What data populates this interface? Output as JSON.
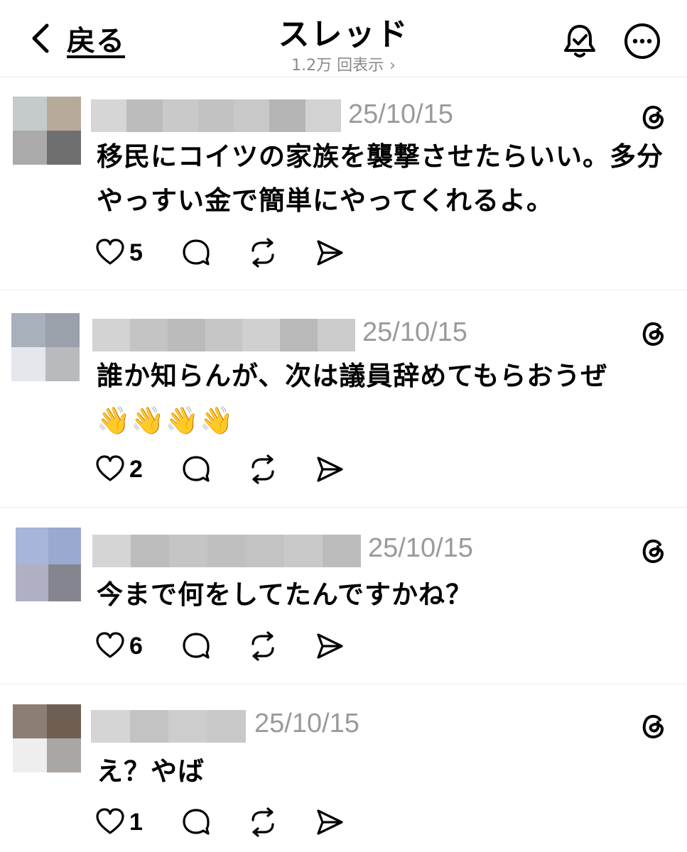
{
  "header": {
    "back_label": "戻る",
    "title": "スレッド",
    "views": "1.2万 回表示",
    "views_chevron": "›"
  },
  "posts": [
    {
      "date": "25/10/15",
      "text": "移民にコイツの家族を襲撃させたらいい。多分やっすい金で簡単にやってくれるよ。",
      "likes": "5"
    },
    {
      "date": "25/10/15",
      "text": "誰か知らんが、次は議員辞めてもらおうぜ",
      "emoji": "👋👋👋👋",
      "likes": "2"
    },
    {
      "date": "25/10/15",
      "text": "今まで何をしてたんですかね？",
      "likes": "6"
    },
    {
      "date": "25/10/15",
      "text": "え？やば",
      "likes": "1"
    }
  ],
  "icons": {
    "back": "chevron-left-icon",
    "bell": "bell-check-icon",
    "more": "more-icon",
    "threads": "threads-logo-icon",
    "like": "heart-icon",
    "reply": "comment-icon",
    "repost": "repost-icon",
    "share": "send-icon"
  },
  "colors": {
    "text": "#000000",
    "muted": "#9a9a9a",
    "divider": "#ececec",
    "background": "#ffffff"
  }
}
